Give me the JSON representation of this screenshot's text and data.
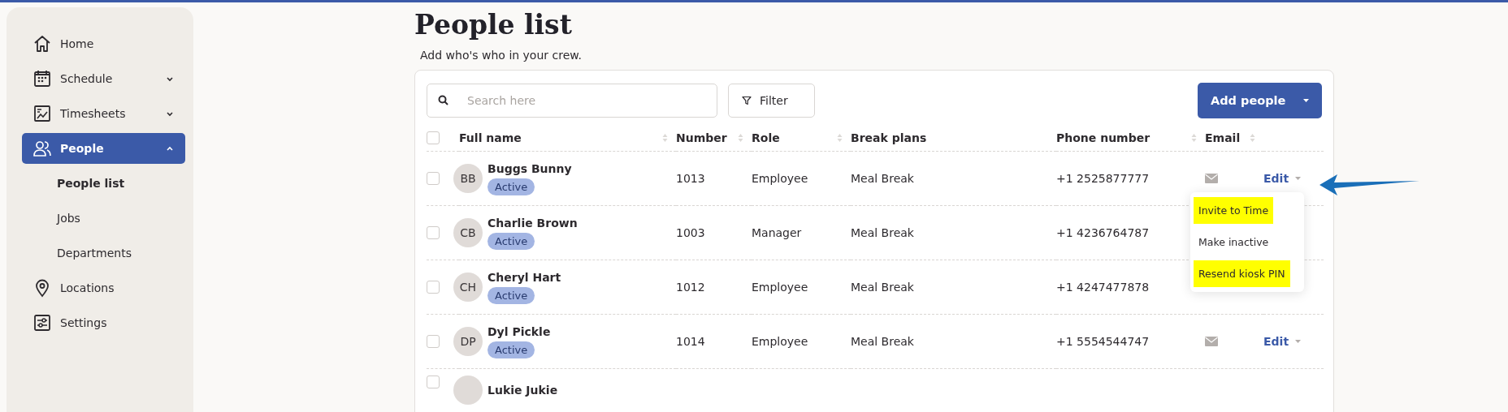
{
  "sidebar": {
    "items": [
      {
        "label": "Home",
        "kind": "home",
        "selected": false
      },
      {
        "label": "Schedule",
        "kind": "calendar",
        "selected": false,
        "expanded": false
      },
      {
        "label": "Timesheets",
        "kind": "chart",
        "selected": false,
        "expanded": false
      },
      {
        "label": "People",
        "kind": "people",
        "selected": true,
        "expanded": true,
        "children": [
          {
            "label": "People list",
            "selected": true
          },
          {
            "label": "Jobs",
            "selected": false
          },
          {
            "label": "Departments",
            "selected": false
          }
        ]
      },
      {
        "label": "Locations",
        "kind": "pin",
        "selected": false
      },
      {
        "label": "Settings",
        "kind": "sliders",
        "selected": false
      }
    ]
  },
  "page": {
    "title": "People list",
    "subtitle": "Add who's who in your crew."
  },
  "toolbar": {
    "search": {
      "placeholder": "Search here"
    },
    "filter": "Filter",
    "add_button": "Add people"
  },
  "table": {
    "select_all_checked": false,
    "columns": [
      {
        "label": "Full name",
        "sortable": true
      },
      {
        "label": "Number",
        "sortable": true
      },
      {
        "label": "Role",
        "sortable": true
      },
      {
        "label": "Break plans",
        "sortable": false
      },
      {
        "label": "Phone number",
        "sortable": true
      },
      {
        "label": "Email",
        "sortable": true
      }
    ],
    "rows": [
      {
        "initials": "BB",
        "name": "Buggs Bunny",
        "status": "Active",
        "number": "1013",
        "role": "Employee",
        "break_plan": "Meal Break",
        "phone": "+1 2525877777",
        "email_icon": true,
        "edit": "Edit",
        "checked": false,
        "menu": [
          {
            "label": "Invite to Time",
            "highlighted": true
          },
          {
            "label": "Make inactive",
            "highlighted": false
          },
          {
            "label": "Resend kiosk PIN",
            "highlighted": true
          }
        ]
      },
      {
        "initials": "CB",
        "name": "Charlie Brown",
        "status": "Active",
        "number": "1003",
        "role": "Manager",
        "break_plan": "Meal Break",
        "phone": "+1 4236764787",
        "checked": false
      },
      {
        "initials": "CH",
        "name": "Cheryl Hart",
        "status": "Active",
        "number": "1012",
        "role": "Employee",
        "break_plan": "Meal Break",
        "phone": "+1 4247477878",
        "checked": false
      },
      {
        "initials": "DP",
        "name": "Dyl Pickle",
        "status": "Active",
        "number": "1014",
        "role": "Employee",
        "break_plan": "Meal Break",
        "phone": "+1 5554544747",
        "email_icon": true,
        "edit": "Edit",
        "checked": false
      },
      {
        "name": "Lukie Jukie",
        "checked": false
      }
    ]
  }
}
